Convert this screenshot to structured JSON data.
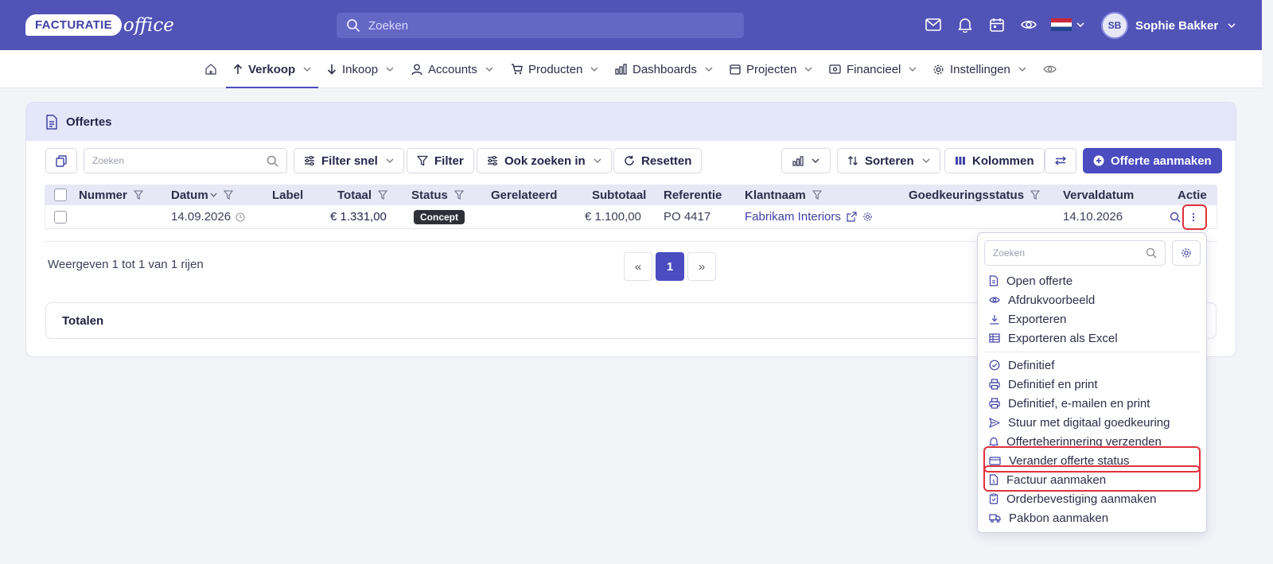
{
  "header": {
    "logo_text": "FACTURATIE",
    "logo_script": "office",
    "search_placeholder": "Zoeken",
    "user_initials": "SB",
    "user_name": "Sophie Bakker"
  },
  "nav": {
    "items": [
      {
        "label": "Verkoop",
        "active": true
      },
      {
        "label": "Inkoop"
      },
      {
        "label": "Accounts"
      },
      {
        "label": "Producten"
      },
      {
        "label": "Dashboards"
      },
      {
        "label": "Projecten"
      },
      {
        "label": "Financieel"
      },
      {
        "label": "Instellingen"
      }
    ]
  },
  "panel": {
    "title": "Offertes",
    "toolbar": {
      "search_placeholder": "Zoeken",
      "filter_quick": "Filter snel",
      "filter": "Filter",
      "also_search": "Ook zoeken in",
      "reset": "Resetten",
      "sort": "Sorteren",
      "columns": "Kolommen",
      "create": "Offerte aanmaken"
    },
    "columns": [
      "Nummer",
      "Datum",
      "Label",
      "Totaal",
      "Status",
      "Gerelateerd",
      "Subtotaal",
      "Referentie",
      "Klantnaam",
      "Goedkeuringsstatus",
      "Vervaldatum",
      "Actie"
    ],
    "rows": [
      {
        "nummer": "",
        "datum": "14.09.2026",
        "label": "",
        "totaal": "€ 1.331,00",
        "status": "Concept",
        "gerelateerd": "",
        "subtotaal": "€ 1.100,00",
        "referentie": "PO 4417",
        "klantnaam": "Fabrikam Interiors",
        "goedkeuringsstatus": "",
        "vervaldatum": "14.10.2026"
      }
    ],
    "info": "Weergeven 1 tot 1 van 1 rijen",
    "pager": {
      "prev": "«",
      "current": "1",
      "next": "»"
    },
    "totals": "Totalen"
  },
  "action_menu": {
    "search_placeholder": "Zoeken",
    "group1": [
      "Open offerte",
      "Afdrukvoorbeeld",
      "Exporteren",
      "Exporteren als Excel"
    ],
    "group2": [
      "Definitief",
      "Definitief en print",
      "Definitief, e-mailen en print",
      "Stuur met digitaal goedkeuring",
      "Offerteherinnering verzenden",
      "Verander offerte status",
      "Factuur aanmaken",
      "Orderbevestiging aanmaken",
      "Pakbon aanmaken"
    ]
  },
  "colors": {
    "brand": "#5153b7",
    "accent": "#4a4cc0",
    "highlight": "#e0323c"
  }
}
